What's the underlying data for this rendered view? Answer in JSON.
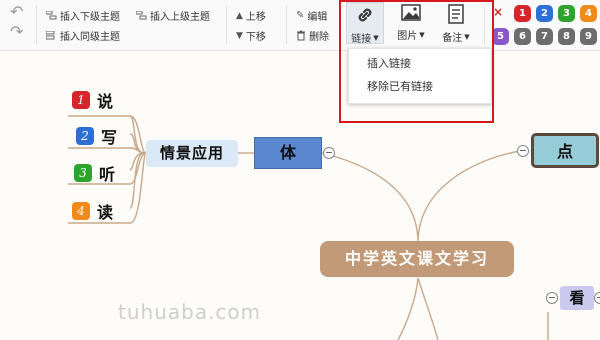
{
  "toolbar": {
    "insert_child": "插入下级主题",
    "insert_parent": "插入上级主题",
    "insert_sibling": "插入同级主题",
    "move_up": "上移",
    "move_down": "下移",
    "edit": "编辑",
    "delete": "删除",
    "link": "链接",
    "image": "图片",
    "note": "备注"
  },
  "priority": {
    "clear": "×",
    "row1": [
      {
        "n": "1",
        "color": "#d7262b"
      },
      {
        "n": "2",
        "color": "#2e6fd6"
      },
      {
        "n": "3",
        "color": "#2ea32e"
      },
      {
        "n": "4",
        "color": "#f08a1c"
      }
    ],
    "row2": [
      {
        "n": "5",
        "color": "#8a57c9"
      },
      {
        "n": "6",
        "color": "#6d6d6d"
      },
      {
        "n": "7",
        "color": "#6d6d6d"
      },
      {
        "n": "8",
        "color": "#6d6d6d"
      },
      {
        "n": "9",
        "color": "#6d6d6d"
      }
    ]
  },
  "link_menu": {
    "insert_link": "插入链接",
    "remove_link": "移除已有链接"
  },
  "mindmap": {
    "root": "中学英文课文学习",
    "ti": "体",
    "dian": "点",
    "kan": "看",
    "scene": "情景应用",
    "leaves": [
      {
        "n": "1",
        "label": "说",
        "color": "#d7262b"
      },
      {
        "n": "2",
        "label": "写",
        "color": "#2e6fd6"
      },
      {
        "n": "3",
        "label": "听",
        "color": "#2ea32e"
      },
      {
        "n": "4",
        "label": "读",
        "color": "#f08a1c"
      }
    ]
  },
  "watermark": "tuhuaba.com"
}
